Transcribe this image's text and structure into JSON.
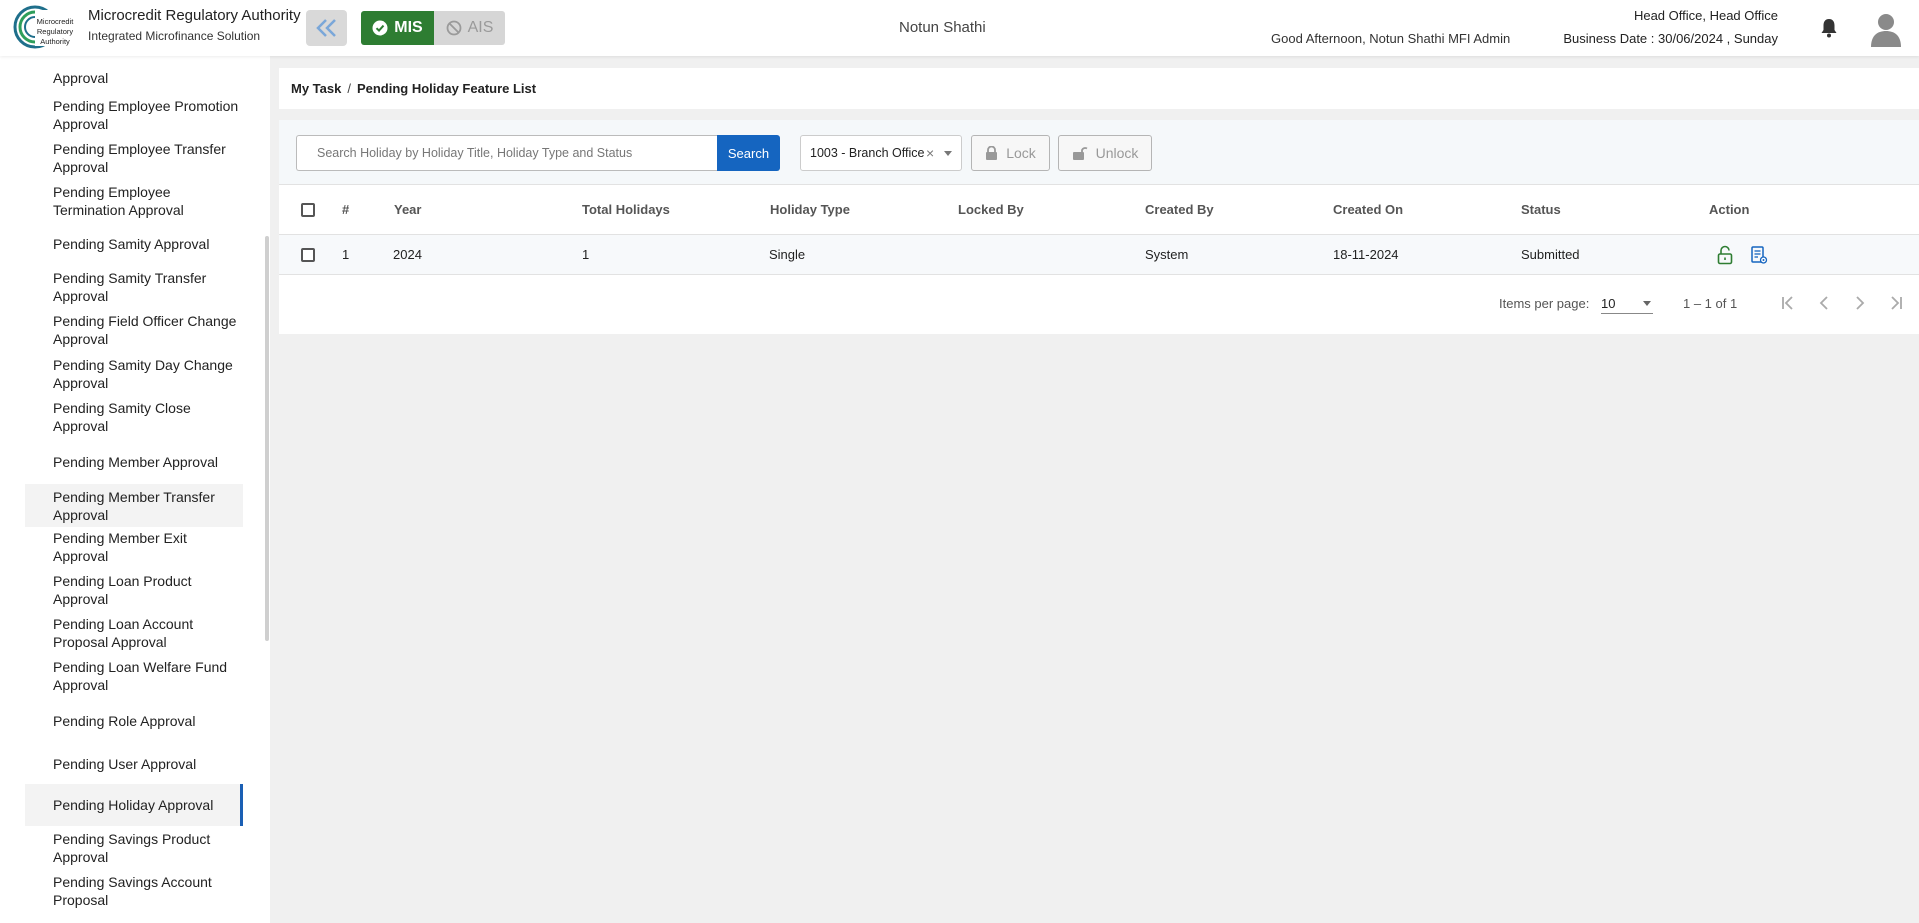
{
  "header": {
    "brand_title": "Microcredit Regulatory Authority",
    "brand_subtitle": "Integrated Microfinance Solution",
    "logo_text_1": "Microcredit",
    "logo_text_2": "Regulatory",
    "logo_text_3": "Authority",
    "mis_label": "MIS",
    "ais_label": "AIS",
    "org_name": "Notun Shathi",
    "greeting": "Good Afternoon, Notun Shathi MFI Admin",
    "office": "Head Office, Head Office",
    "business_date": "Business Date : 30/06/2024 , Sunday",
    "icons": {
      "collapse": "double-chevron-left-icon",
      "mis": "check-circle-icon",
      "ais": "ban-icon",
      "bell": "bell-icon",
      "avatar": "user-avatar-icon"
    }
  },
  "sidebar": {
    "items": [
      {
        "label": "Approval"
      },
      {
        "label": "Pending Employee Promotion Approval"
      },
      {
        "label": "Pending Employee Transfer Approval"
      },
      {
        "label": "Pending Employee Termination Approval"
      },
      {
        "label": "Pending Samity Approval"
      },
      {
        "label": "Pending Samity Transfer Approval"
      },
      {
        "label": "Pending Field Officer Change Approval"
      },
      {
        "label": "Pending Samity Day Change Approval"
      },
      {
        "label": "Pending Samity Close Approval"
      },
      {
        "label": "Pending Member Approval"
      },
      {
        "label": "Pending Member Transfer Approval"
      },
      {
        "label": "Pending Member Exit Approval"
      },
      {
        "label": "Pending Loan Product Approval"
      },
      {
        "label": "Pending Loan Account Proposal Approval"
      },
      {
        "label": "Pending Loan Welfare Fund Approval"
      },
      {
        "label": "Pending Role Approval"
      },
      {
        "label": "Pending User Approval"
      },
      {
        "label": "Pending Holiday Approval"
      },
      {
        "label": "Pending Savings Product Approval"
      },
      {
        "label": "Pending Savings Account Proposal"
      }
    ],
    "active_color": "#1a5fb4"
  },
  "breadcrumb": {
    "root": "My Task",
    "separator": "/",
    "current": "Pending Holiday Feature List"
  },
  "toolbar": {
    "search_placeholder": "Search Holiday by Holiday Title, Holiday Type and Status",
    "search_label": "Search",
    "branch_value": "1003 - Branch Office",
    "lock_label": "Lock",
    "unlock_label": "Unlock",
    "accent": "#1565c0"
  },
  "table": {
    "columns": [
      "#",
      "Year",
      "Total Holidays",
      "Holiday Type",
      "Locked By",
      "Created By",
      "Created On",
      "Status",
      "Action"
    ],
    "rows": [
      {
        "index": "1",
        "year": "2024",
        "total": "1",
        "type": "Single",
        "locked_by": "",
        "created_by": "System",
        "created_on": "18-11-2024",
        "status": "Submitted"
      }
    ],
    "action_icons": [
      "unlock-icon",
      "view-document-icon"
    ]
  },
  "paginator": {
    "items_per_page_label": "Items per page:",
    "page_size": "10",
    "range": "1 – 1 of 1"
  }
}
